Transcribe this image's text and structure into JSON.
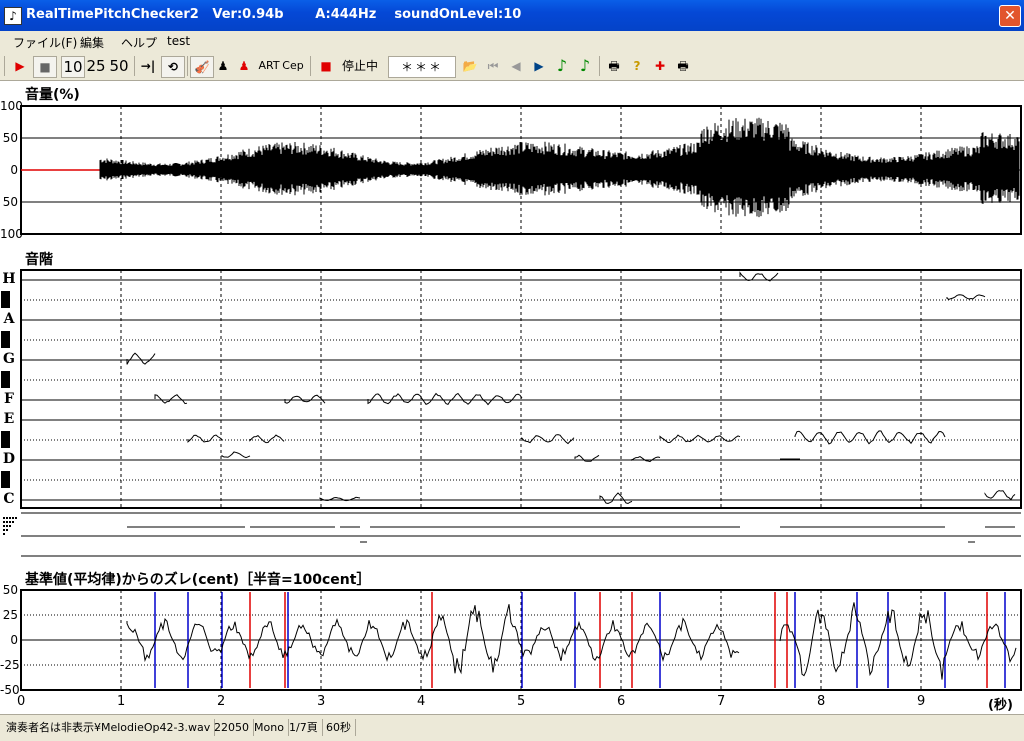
{
  "window": {
    "title": "RealTimePitchChecker2   Ver:0.94b       A:444Hz    soundOnLevel:10",
    "app_icon": "music-note-icon",
    "close_glyph": "✕"
  },
  "menu": [
    "ファイル(F)",
    "編集",
    "ヘルプ",
    "test"
  ],
  "toolbar": {
    "play_glyph": "▶",
    "stop_glyph": "■",
    "speed_10": "10",
    "speed_25": "25",
    "speed_50": "50",
    "skip_glyph": "→|",
    "loop_glyph": "⟲",
    "violin_glyph": "🎻",
    "player_black_glyph": "♟",
    "player_red_glyph": "♟",
    "art_label": "ART",
    "cep_label": "Cep",
    "rec_glyph": "■",
    "status_label": "停止中",
    "note_display": "＊＊＊",
    "open_glyph": "📂",
    "first_glyph": "⏮",
    "prev_glyph": "◀",
    "next_glyph": "▶",
    "note1_glyph": "♪",
    "note2_glyph": "♪",
    "print_glyph": "🖶",
    "help_glyph": "?",
    "mark_glyph": "✚",
    "print2_glyph": "🖶"
  },
  "panels": {
    "volume": {
      "title": "音量(%)",
      "ticks": [
        "100",
        "50",
        "0",
        "50",
        "100"
      ]
    },
    "scale": {
      "title": "音階",
      "notes": [
        "H",
        "A",
        "G",
        "F",
        "E",
        "D",
        "C"
      ]
    },
    "deviation": {
      "title": "基準値(平均律)からのズレ(cent)［半音=100cent］",
      "ticks": [
        "50",
        "25",
        "0",
        "-25",
        "-50"
      ]
    }
  },
  "x_axis": {
    "ticks": [
      "0",
      "1",
      "2",
      "3",
      "4",
      "5",
      "6",
      "7",
      "8",
      "9"
    ],
    "unit": "(秒)"
  },
  "colors": {
    "accent_red": "#e00000",
    "accent_blue": "#0000cc",
    "grid": "#000000"
  },
  "statusbar": [
    "演奏者名は非表示¥MelodieOp42-3.wav",
    "22050",
    "Mono",
    "1/7頁",
    "60秒"
  ]
}
